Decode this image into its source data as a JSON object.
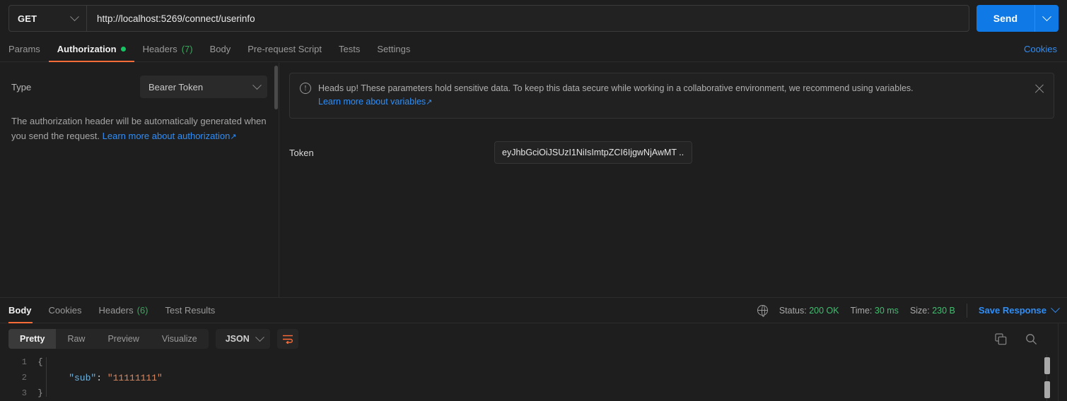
{
  "request": {
    "method": "GET",
    "url": "http://localhost:5269/connect/userinfo",
    "send_label": "Send",
    "tabs": [
      {
        "label": "Params",
        "active": false,
        "badge": "",
        "dot": false
      },
      {
        "label": "Authorization",
        "active": true,
        "badge": "",
        "dot": true
      },
      {
        "label": "Headers",
        "active": false,
        "badge": "(7)",
        "dot": false
      },
      {
        "label": "Body",
        "active": false,
        "badge": "",
        "dot": false
      },
      {
        "label": "Pre-request Script",
        "active": false,
        "badge": "",
        "dot": false
      },
      {
        "label": "Tests",
        "active": false,
        "badge": "",
        "dot": false
      },
      {
        "label": "Settings",
        "active": false,
        "badge": "",
        "dot": false
      }
    ],
    "cookies_link": "Cookies"
  },
  "auth": {
    "type_label": "Type",
    "type_value": "Bearer Token",
    "note_text": "The authorization header will be automatically generated when you send the request. ",
    "note_link": "Learn more about authorization",
    "note_link_arrow": "↗",
    "heads_up_text": "Heads up! These parameters hold sensitive data. To keep this data secure while working in a collaborative environment, we recommend using variables.",
    "heads_up_link": "Learn more about variables",
    "heads_up_link_arrow": "↗",
    "token_label": "Token",
    "token_value": "eyJhbGciOiJSUzI1NiIsImtpZCI6IjgwNjAwMT ..."
  },
  "response": {
    "tabs": [
      {
        "label": "Body",
        "active": true,
        "badge": ""
      },
      {
        "label": "Cookies",
        "active": false,
        "badge": ""
      },
      {
        "label": "Headers",
        "active": false,
        "badge": "(6)"
      },
      {
        "label": "Test Results",
        "active": false,
        "badge": ""
      }
    ],
    "status_label": "Status:",
    "status_value": "200 OK",
    "time_label": "Time:",
    "time_value": "30 ms",
    "size_label": "Size:",
    "size_value": "230 B",
    "save_label": "Save Response",
    "view_modes": [
      {
        "label": "Pretty",
        "active": true
      },
      {
        "label": "Raw",
        "active": false
      },
      {
        "label": "Preview",
        "active": false
      },
      {
        "label": "Visualize",
        "active": false
      }
    ],
    "format": "JSON",
    "body_lines": [
      {
        "num": "1",
        "fold": "{",
        "segments": []
      },
      {
        "num": "2",
        "fold": "",
        "segments": [
          {
            "text": "    \"sub\"",
            "cls": "k-key"
          },
          {
            "text": ": ",
            "cls": "k-punc"
          },
          {
            "text": "\"11111111\"",
            "cls": "k-str"
          }
        ]
      },
      {
        "num": "3",
        "fold": "}",
        "segments": []
      }
    ]
  },
  "colors": {
    "accent_orange": "#ff6c37",
    "link_blue": "#2f8ef7",
    "send_blue": "#0f7ae5",
    "status_green": "#3fbf6f",
    "dot_green": "#16c464"
  }
}
